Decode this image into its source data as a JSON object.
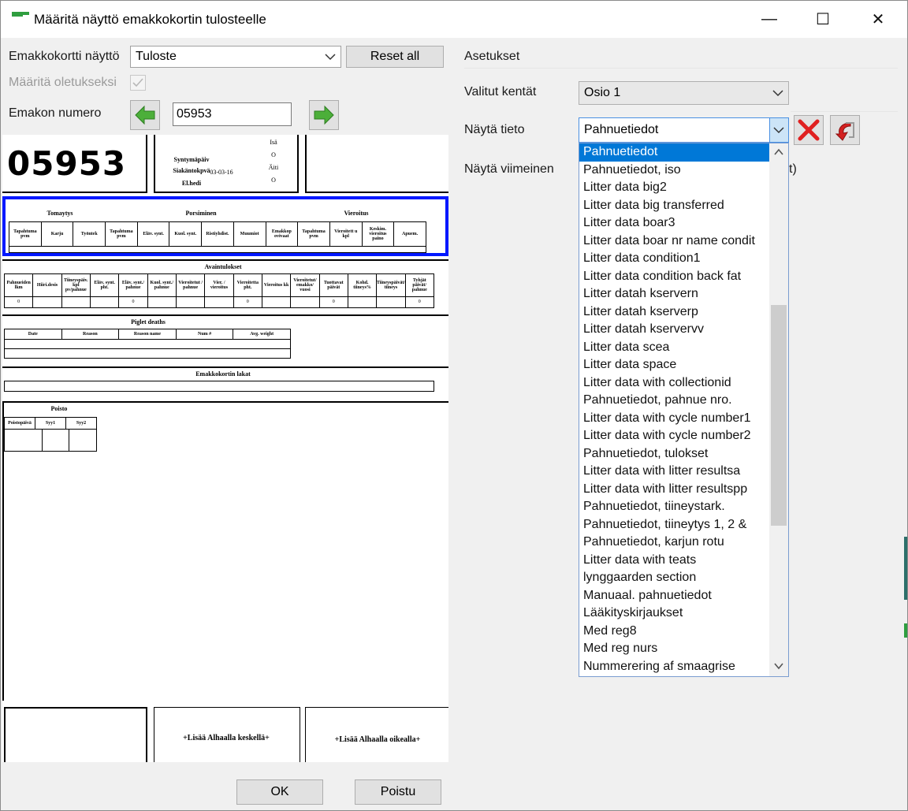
{
  "window": {
    "title": "Määritä näyttö emakkokortin tulosteelle",
    "minimize": "—",
    "maximize": "☐",
    "close": "✕"
  },
  "left": {
    "display_label": "Emakkokortti näyttö",
    "display_value": "Tuloste",
    "reset_label": "Reset all",
    "default_label": "Määritä oletukseksi",
    "sow_number_label": "Emakon numero",
    "sow_number_value": "05953"
  },
  "preview": {
    "big_number": "05953",
    "header_lines": [
      "Syntymäpäiv",
      "Siakäntokpvä",
      "El.hedi"
    ],
    "header_date": "03-03-16",
    "header_small": [
      "Isä",
      "O",
      "Äiti",
      "O"
    ],
    "sections": {
      "sec1": [
        "Tomaytys",
        "Porsiminen",
        "Vieroitus"
      ],
      "sec1_cols": [
        "Tapahtuma pvm",
        "Karju",
        "Työntek",
        "Tapahtuma pvm",
        "Eläv. synt.",
        "Kuol. synt.",
        "Ristiyhdist.",
        "Muumiot",
        "Emakkop ovivaat",
        "Tapahtuma pvm",
        "Vieroitett u kpl",
        "Keskim. vieroitus paino",
        "Apuem."
      ],
      "sec2_title": "Avaintulokset",
      "sec2_cols": [
        "Pahnueiden lkm",
        "Hiiri.desis",
        "Tiineyspäiv. kpl pv/pahnue",
        "Eläv. synt. pht.",
        "Eläv. synt./ pahnue",
        "Kuol. synt./ pahnue",
        "Vieroitetut / pahnue",
        "Vier. / vieroitus",
        "Vieroitetta pht.",
        "Vieroitus kk",
        "Vieroitetut/ emakko/ vuosi",
        "Tuottavat päivät",
        "Kohd. tiineys%",
        "Tiineyspäivät/ tiineys",
        "Tyhjät päivät/ pahnue"
      ],
      "sec2_vals": [
        "0",
        "0",
        "0",
        "0",
        "0"
      ],
      "sec3_title": "Piglet deaths",
      "sec3_cols": [
        "Date",
        "Reason",
        "Reason name",
        "Num #",
        "Avg. weight"
      ],
      "sec4_title": "Emakkokortin lakat",
      "sec5_title": "Poisto",
      "sec5_cols": [
        "Poistopäivä",
        "Syy1",
        "Syy2"
      ],
      "footer_mid": "+Lisää Alhaalla keskellä+",
      "footer_right": "+Lisää Alhaalla oikealla+"
    }
  },
  "right": {
    "settings_title": "Asetukset",
    "selected_fields_label": "Valitut kentät",
    "selected_fields_value": "Osio 1",
    "show_info_label": "Näytä tieto",
    "show_info_value": "Pahnuetiedot",
    "show_last_label": "Näytä viimeinen",
    "partial_text": "t)"
  },
  "dropdown": {
    "items": [
      "Pahnuetiedot",
      "Pahnuetiedot, iso",
      "Litter data big2",
      "Litter data big transferred",
      "Litter data boar3",
      "Litter data boar nr name condit",
      "Litter data condition1",
      "Litter data condition back fat",
      "Litter datah kservern",
      "Litter datah kserverp",
      "Litter datah kservervv",
      "Litter data scea",
      "Litter data space",
      "Litter data with collectionid",
      "Pahnuetiedot, pahnue nro.",
      "Litter data with cycle number1",
      "Litter data with cycle number2",
      "Pahnuetiedot, tulokset",
      "Litter data with litter resultsa",
      "Litter data with litter resultspp",
      "Pahnuetiedot, tiineystark.",
      "Pahnuetiedot, tiineytys 1, 2 &",
      "Pahnuetiedot, karjun rotu",
      "Litter data with teats",
      "lynggaarden section",
      "Manuaal. pahnuetiedot",
      "Lääkityskirjaukset",
      "Med reg8",
      "Med reg nurs",
      "Nummerering af smaagrise"
    ],
    "selected_index": 0
  },
  "footer": {
    "ok_label": "OK",
    "exit_label": "Poistu"
  },
  "colors": {
    "selection": "#0078d7",
    "section_highlight": "#0018ff",
    "accent_green": "#2f9e3f",
    "delete_red": "#e02020"
  },
  "icons": [
    "app-icon",
    "chevron-down-icon",
    "checkbox-icon",
    "arrow-left-icon",
    "arrow-right-icon",
    "delete-icon",
    "move-icon",
    "scroll-up-icon",
    "scroll-down-icon"
  ]
}
